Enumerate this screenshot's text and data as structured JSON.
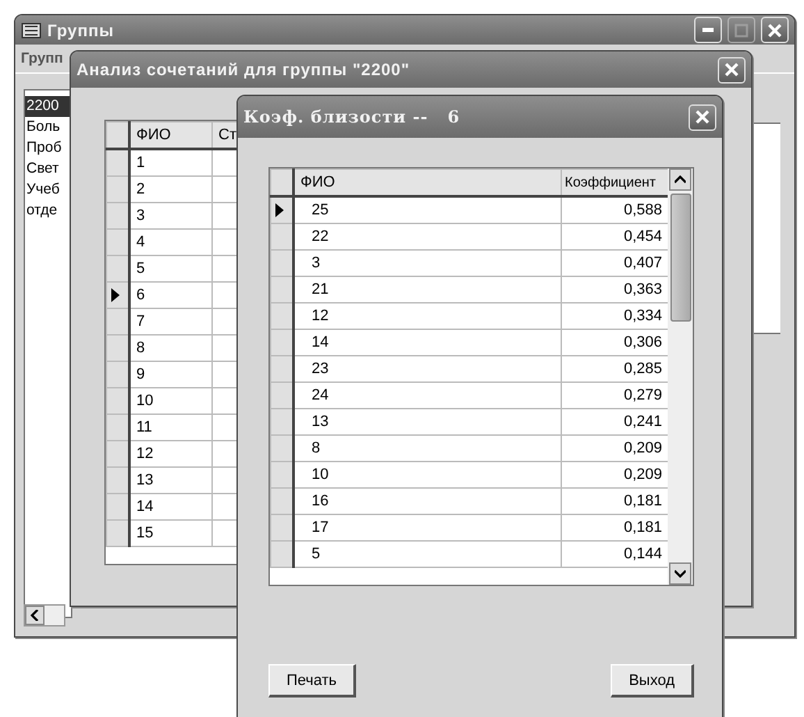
{
  "windows": [
    {
      "kind": "groups",
      "title": "Группы",
      "menu": [
        "Групп"
      ],
      "list": [
        {
          "label": "2200",
          "selected": true
        },
        {
          "label": "Боль",
          "selected": false
        },
        {
          "label": "Проб",
          "selected": false
        },
        {
          "label": "Свет",
          "selected": false
        },
        {
          "label": "Учеб",
          "selected": false
        },
        {
          "label": "отде",
          "selected": false
        }
      ]
    },
    {
      "kind": "analysis",
      "title": "Анализ сочетаний для группы \"2200\"",
      "columns": [
        "ФИО",
        "Ст"
      ],
      "rows": [
        {
          "cells": [
            "1"
          ],
          "selected": false
        },
        {
          "cells": [
            "2"
          ],
          "selected": false
        },
        {
          "cells": [
            "3"
          ],
          "selected": false
        },
        {
          "cells": [
            "4"
          ],
          "selected": false
        },
        {
          "cells": [
            "5"
          ],
          "selected": false
        },
        {
          "cells": [
            "6"
          ],
          "selected": true
        },
        {
          "cells": [
            "7"
          ],
          "selected": false
        },
        {
          "cells": [
            "8"
          ],
          "selected": false
        },
        {
          "cells": [
            "9"
          ],
          "selected": false
        },
        {
          "cells": [
            "10"
          ],
          "selected": false
        },
        {
          "cells": [
            "11"
          ],
          "selected": false
        },
        {
          "cells": [
            "12"
          ],
          "selected": false
        },
        {
          "cells": [
            "13"
          ],
          "selected": false
        },
        {
          "cells": [
            "14"
          ],
          "selected": false
        },
        {
          "cells": [
            "15"
          ],
          "selected": false
        }
      ]
    },
    {
      "kind": "closeness",
      "title": "Коэф. близости --   6",
      "columns": [
        "ФИО",
        "Коэффициент"
      ],
      "rows": [
        {
          "cells": [
            "25",
            "0,588"
          ],
          "selected": true
        },
        {
          "cells": [
            "22",
            "0,454"
          ],
          "selected": false
        },
        {
          "cells": [
            "3",
            "0,407"
          ],
          "selected": false
        },
        {
          "cells": [
            "21",
            "0,363"
          ],
          "selected": false
        },
        {
          "cells": [
            "12",
            "0,334"
          ],
          "selected": false
        },
        {
          "cells": [
            "14",
            "0,306"
          ],
          "selected": false
        },
        {
          "cells": [
            "23",
            "0,285"
          ],
          "selected": false
        },
        {
          "cells": [
            "24",
            "0,279"
          ],
          "selected": false
        },
        {
          "cells": [
            "13",
            "0,241"
          ],
          "selected": false
        },
        {
          "cells": [
            "8",
            "0,209"
          ],
          "selected": false
        },
        {
          "cells": [
            "10",
            "0,209"
          ],
          "selected": false
        },
        {
          "cells": [
            "16",
            "0,181"
          ],
          "selected": false
        },
        {
          "cells": [
            "17",
            "0,181"
          ],
          "selected": false
        },
        {
          "cells": [
            "5",
            "0,144"
          ],
          "selected": false
        }
      ],
      "buttons": [
        "Печать",
        "Выход"
      ]
    }
  ]
}
